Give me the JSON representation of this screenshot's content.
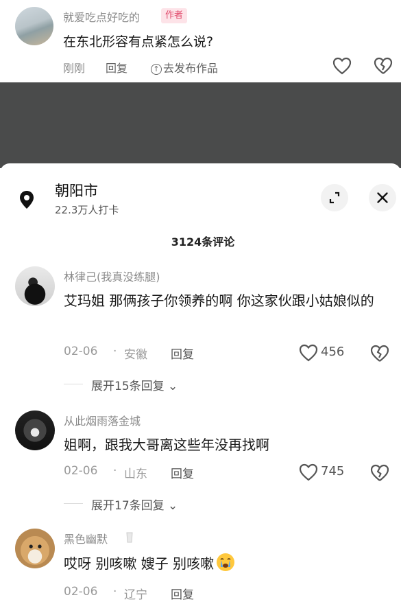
{
  "top_comment": {
    "username": "就爱吃点好吃的",
    "author_tag": "作者",
    "content": "在东北形容有点紧怎么说?",
    "time": "刚刚",
    "reply": "回复",
    "publish": "去发布作品"
  },
  "location": {
    "name": "朝阳市",
    "checkins": "22.3万人打卡"
  },
  "comments_title": "3124条评论",
  "comments": [
    {
      "username": "林律己(我真没练腿)",
      "text": "艾玛姐 那俩孩子你领养的啊 你这家伙跟小姑娘似的",
      "date": "02-06",
      "region": "安徽",
      "reply": "回复",
      "likes": "456",
      "expand": "展开15条回复"
    },
    {
      "username": "从此烟雨落金城",
      "text": "姐啊，跟我大哥离这些年没再找啊",
      "date": "02-06",
      "region": "山东",
      "reply": "回复",
      "likes": "745",
      "expand": "展开17条回复"
    },
    {
      "username": "黑色幽默",
      "text": "哎呀 别咳嗽 嫂子 别咳嗽",
      "date": "02-06",
      "region": "辽宁",
      "reply": "回复"
    }
  ],
  "icons": {
    "location": "map-pin-icon",
    "expand": "expand-icon",
    "close": "close-icon",
    "like": "heart-icon",
    "dislike": "broken-heart-icon",
    "emoji": "crying-face-icon"
  },
  "colors": {
    "author_tag_text": "#e0486a",
    "author_tag_bg": "#fde3e8",
    "dark_band": "#4a4b4b"
  }
}
